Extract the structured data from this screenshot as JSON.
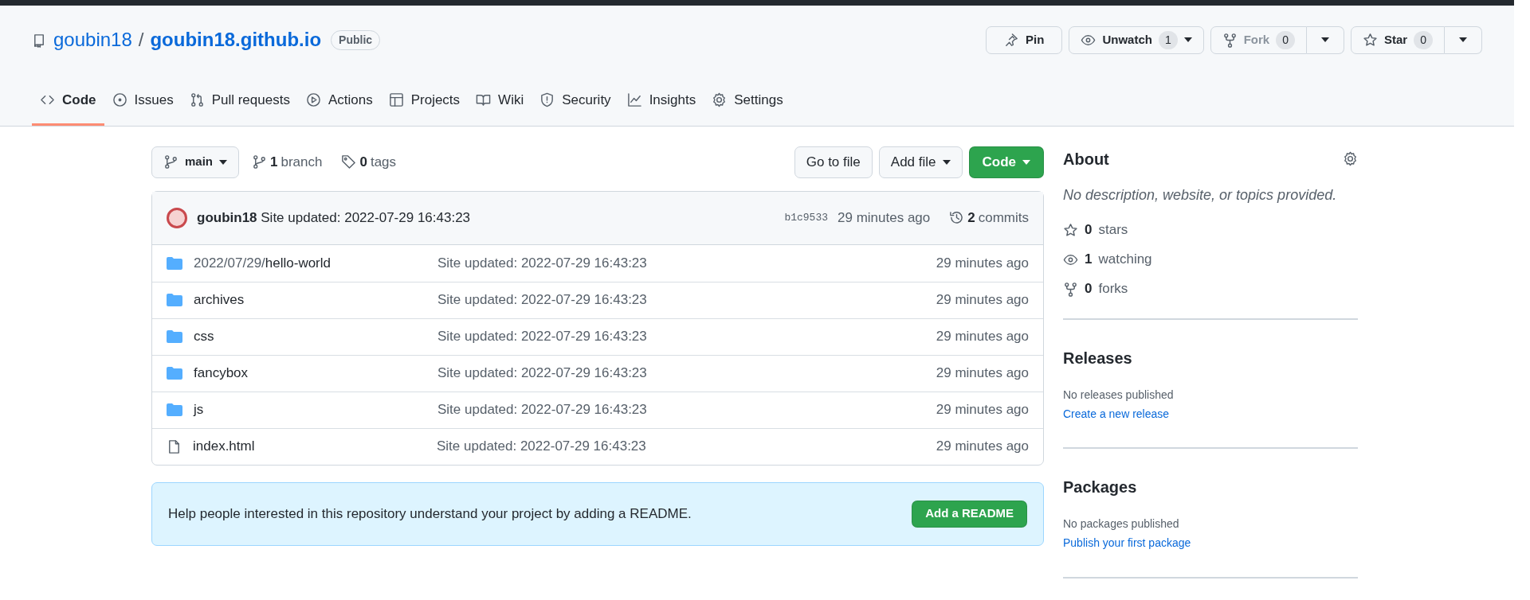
{
  "repo": {
    "owner": "goubin18",
    "separator": "/",
    "name": "goubin18.github.io",
    "visibility": "Public"
  },
  "actions": [
    {
      "kind": "pin",
      "label": "Pin",
      "disabled": false
    },
    {
      "kind": "watch",
      "label": "Unwatch",
      "count": "1",
      "disabled": false
    },
    {
      "kind": "fork",
      "label": "Fork",
      "count": "0",
      "disabled": true
    },
    {
      "kind": "star",
      "label": "Star",
      "count": "0",
      "disabled": false
    }
  ],
  "tabs": [
    {
      "kind": "code",
      "label": "Code",
      "selected": true
    },
    {
      "kind": "issues",
      "label": "Issues",
      "selected": false
    },
    {
      "kind": "pulls",
      "label": "Pull requests",
      "selected": false
    },
    {
      "kind": "actions",
      "label": "Actions",
      "selected": false
    },
    {
      "kind": "projects",
      "label": "Projects",
      "selected": false
    },
    {
      "kind": "wiki",
      "label": "Wiki",
      "selected": false
    },
    {
      "kind": "security",
      "label": "Security",
      "selected": false
    },
    {
      "kind": "insights",
      "label": "Insights",
      "selected": false
    },
    {
      "kind": "settings",
      "label": "Settings",
      "selected": false
    }
  ],
  "branch_bar": {
    "branch": "main",
    "branch_count": "1",
    "branch_label": "branch",
    "tag_count": "0",
    "tag_label": "tags",
    "buttons": [
      {
        "kind": "plain",
        "label": "Go to file"
      },
      {
        "kind": "dropdown",
        "label": "Add file"
      },
      {
        "kind": "primary",
        "label": "Code"
      }
    ]
  },
  "commit": {
    "author": "goubin18",
    "message": "Site updated: 2022-07-29 16:43:23",
    "sha": "b1c9533",
    "time": "29 minutes ago",
    "commits_count": "2",
    "commits_label": "commits"
  },
  "files": [
    {
      "kind": "folder",
      "path_prefix": "2022/07/29/",
      "name": "hello-world",
      "message": "Site updated: 2022-07-29 16:43:23",
      "time": "29 minutes ago"
    },
    {
      "kind": "folder",
      "name": "archives",
      "message": "Site updated: 2022-07-29 16:43:23",
      "time": "29 minutes ago"
    },
    {
      "kind": "folder",
      "name": "css",
      "message": "Site updated: 2022-07-29 16:43:23",
      "time": "29 minutes ago"
    },
    {
      "kind": "folder",
      "name": "fancybox",
      "message": "Site updated: 2022-07-29 16:43:23",
      "time": "29 minutes ago"
    },
    {
      "kind": "folder",
      "name": "js",
      "message": "Site updated: 2022-07-29 16:43:23",
      "time": "29 minutes ago"
    },
    {
      "kind": "file",
      "name": "index.html",
      "message": "Site updated: 2022-07-29 16:43:23",
      "time": "29 minutes ago"
    }
  ],
  "readme": {
    "text": "Help people interested in this repository understand your project by adding a README.",
    "button": "Add a README"
  },
  "about": {
    "title": "About",
    "description": "No description, website, or topics provided.",
    "stats": [
      {
        "kind": "star",
        "count": "0",
        "label": "stars"
      },
      {
        "kind": "eye",
        "count": "1",
        "label": "watching"
      },
      {
        "kind": "fork",
        "count": "0",
        "label": "forks"
      }
    ]
  },
  "sections": [
    {
      "title": "Releases",
      "text": "No releases published",
      "link": "Create a new release"
    },
    {
      "title": "Packages",
      "text": "No packages published",
      "link": "Publish your first package"
    }
  ]
}
